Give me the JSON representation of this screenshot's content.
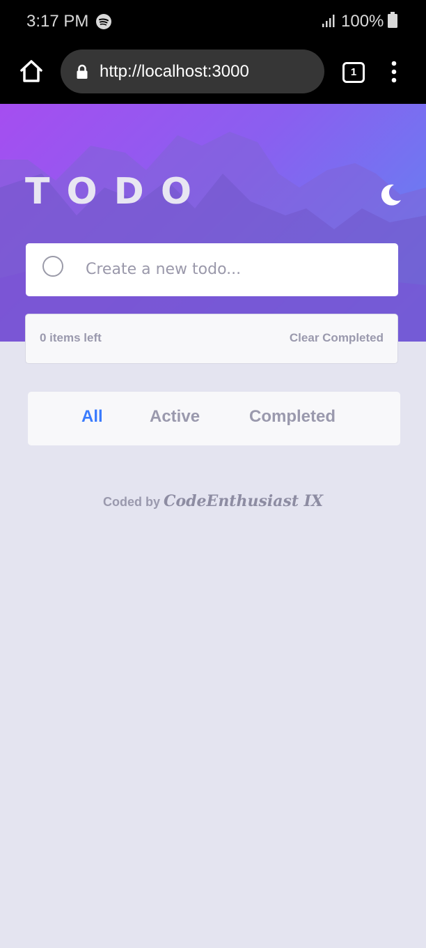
{
  "status_bar": {
    "time": "3:17 PM",
    "battery": "100%",
    "icons": [
      "spotify-icon",
      "signal-icon",
      "battery-icon"
    ]
  },
  "browser": {
    "url": "http://localhost:3000",
    "tab_count": "1",
    "icons": [
      "home-icon",
      "lock-icon",
      "menu-icon"
    ]
  },
  "app": {
    "title": "TODO",
    "theme_toggle_icon": "moon-icon",
    "new_todo": {
      "placeholder": "Create a new todo..."
    },
    "items_left": "0 items left",
    "clear_completed": "Clear Completed",
    "filters": [
      {
        "label": "All",
        "active": true
      },
      {
        "label": "Active",
        "active": false
      },
      {
        "label": "Completed",
        "active": false
      }
    ],
    "credit": {
      "prefix": "Coded by",
      "author": "CodeEnthusiast IX"
    }
  },
  "colors": {
    "accent": "#3a7bfd",
    "background": "#e4e4f0",
    "muted_text": "#9a99ad",
    "hero_gradient_start": "#a54ef0",
    "hero_gradient_end": "#5b8af2"
  }
}
